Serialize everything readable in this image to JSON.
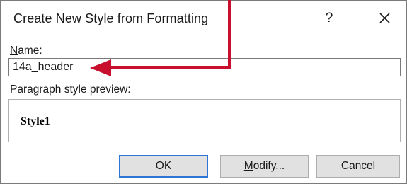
{
  "dialog": {
    "title": "Create New Style from Formatting",
    "help_label": "?",
    "close_icon": "close-icon"
  },
  "name_field": {
    "label_underlined": "N",
    "label_rest": "ame:",
    "value": "14a_header"
  },
  "preview": {
    "label": "Paragraph style preview:",
    "text": "Style1"
  },
  "buttons": {
    "ok": "OK",
    "modify_underlined": "M",
    "modify_rest": "odify...",
    "cancel": "Cancel"
  },
  "colors": {
    "annotation_arrow": "#c8102e",
    "default_button_border": "#2f75d6"
  }
}
